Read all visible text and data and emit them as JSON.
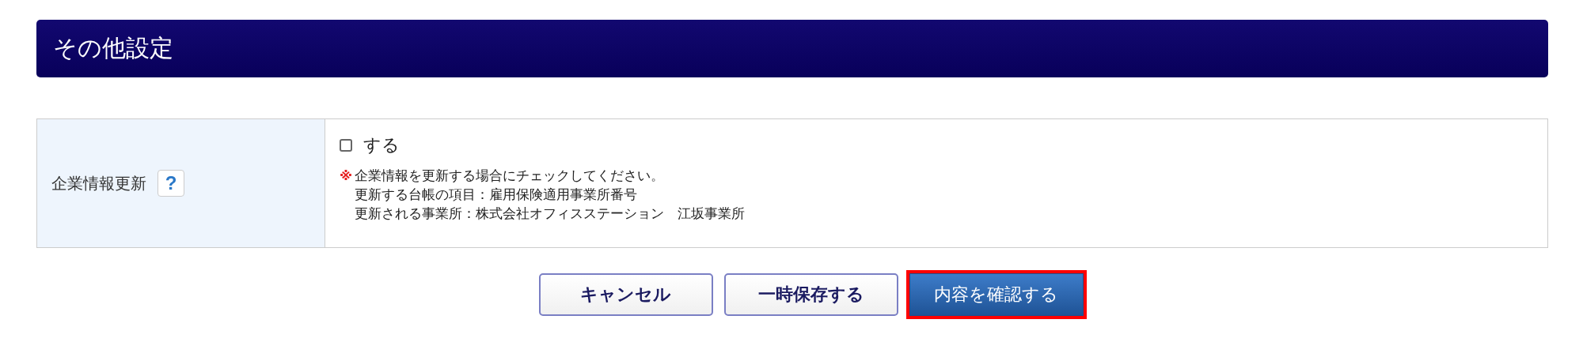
{
  "section": {
    "title": "その他設定"
  },
  "form_rows": [
    {
      "label": "企業情報更新",
      "help": "?",
      "checkbox": {
        "label": "する",
        "checked": false
      },
      "note_mark": "※",
      "notes": [
        "企業情報を更新する場合にチェックしてください。",
        "更新する台帳の項目：雇用保険適用事業所番号",
        "更新される事業所：株式会社オフィスステーション　江坂事業所"
      ]
    }
  ],
  "buttons": [
    {
      "label": "キャンセル",
      "kind": "secondary",
      "highlighted": false
    },
    {
      "label": "一時保存する",
      "kind": "secondary",
      "highlighted": false
    },
    {
      "label": "内容を確認する",
      "kind": "primary",
      "highlighted": true
    }
  ]
}
